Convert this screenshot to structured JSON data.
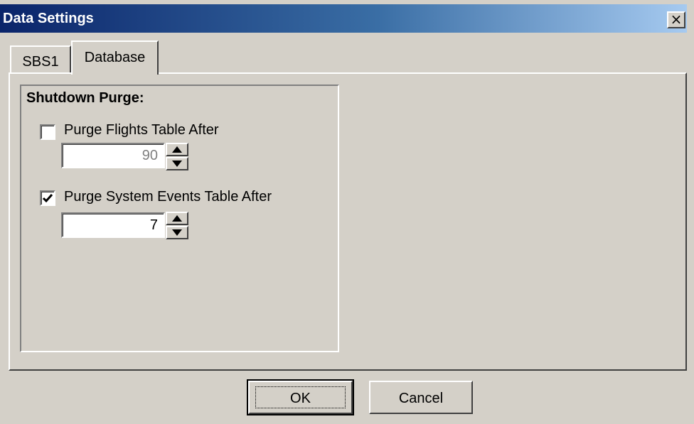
{
  "window": {
    "title": "Data Settings",
    "close_label": "×"
  },
  "tabs": [
    {
      "label": "SBS1",
      "selected": false
    },
    {
      "label": "Database",
      "selected": true
    }
  ],
  "shutdown_purge": {
    "title": "Shutdown Purge:",
    "flights": {
      "label": "Purge Flights Table After",
      "checked": false,
      "value": "90",
      "enabled": false
    },
    "system_events": {
      "label": "Purge System Events Table After",
      "checked": true,
      "value": "7",
      "enabled": true
    }
  },
  "buttons": {
    "ok_label": "OK",
    "cancel_label": "Cancel"
  },
  "icons": {
    "close": "close-icon",
    "check": "checkmark-icon",
    "up": "arrow-up-icon",
    "down": "arrow-down-icon"
  }
}
